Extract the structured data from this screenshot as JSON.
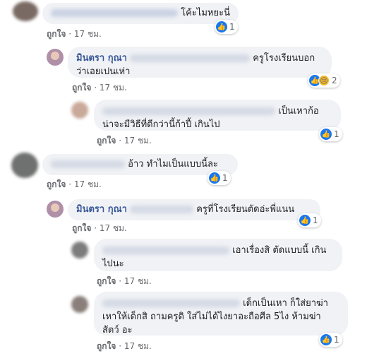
{
  "comments": [
    {
      "text": "โค้ะไมหยะนี่",
      "time": "17 ชม.",
      "like_label": "ถูกใจ",
      "reaction_count": "1"
    },
    {
      "author": "มินตรา กุณา",
      "text_line1": "ครูโรงเรียนบอก",
      "text_line2": "ว่าเอยเปนเห่า",
      "time": "17 ชม.",
      "like_label": "ถูกใจ",
      "reaction_count": "2"
    },
    {
      "text_line1": "เป็นเหาก้อ",
      "text_line2": "น่าจะมีวิธีที่ดีกว่านี้ก้าปี้ เกินไป",
      "time": "17 ชม.",
      "like_label": "ถูกใจ",
      "reaction_count": "1"
    },
    {
      "text": "อ้าว ทำไมเป็นแบบนี้ละ",
      "time": "17 ชม.",
      "like_label": "ถูกใจ",
      "reaction_count": "1"
    },
    {
      "author": "มินตรา กุณา",
      "text": "ครูที่โรงเรียนตัดอ่ะพี่แนน",
      "time": "17 ชม.",
      "like_label": "ถูกใจ",
      "reaction_count": "1"
    },
    {
      "text_line1": "เอาเรื่องสิ ตัดแบบนี้ เกิน",
      "text_line2": "ไปนะ",
      "time": "17 ชม.",
      "like_label": "ถูกใจ"
    },
    {
      "text_line1": "เด็กเป็นเหา ก็ใส่ยาฆ่า",
      "text_line2": "เหาให้เด็กสิ ถามครูดิ ใส่ไม่ได้ไงยาอะถือศีล 5ไง ห้ามฆ่า",
      "text_line3": "สัตว์ อะ",
      "time": "17 ชม.",
      "like_label": "ถูกใจ",
      "reaction_count": "1"
    }
  ],
  "icons": {
    "like": "like-reaction-icon",
    "sad": "sad-reaction-icon"
  },
  "colors": {
    "bubble": "#f0f2f5",
    "name": "#385898",
    "like_blue": "#1877f2"
  }
}
